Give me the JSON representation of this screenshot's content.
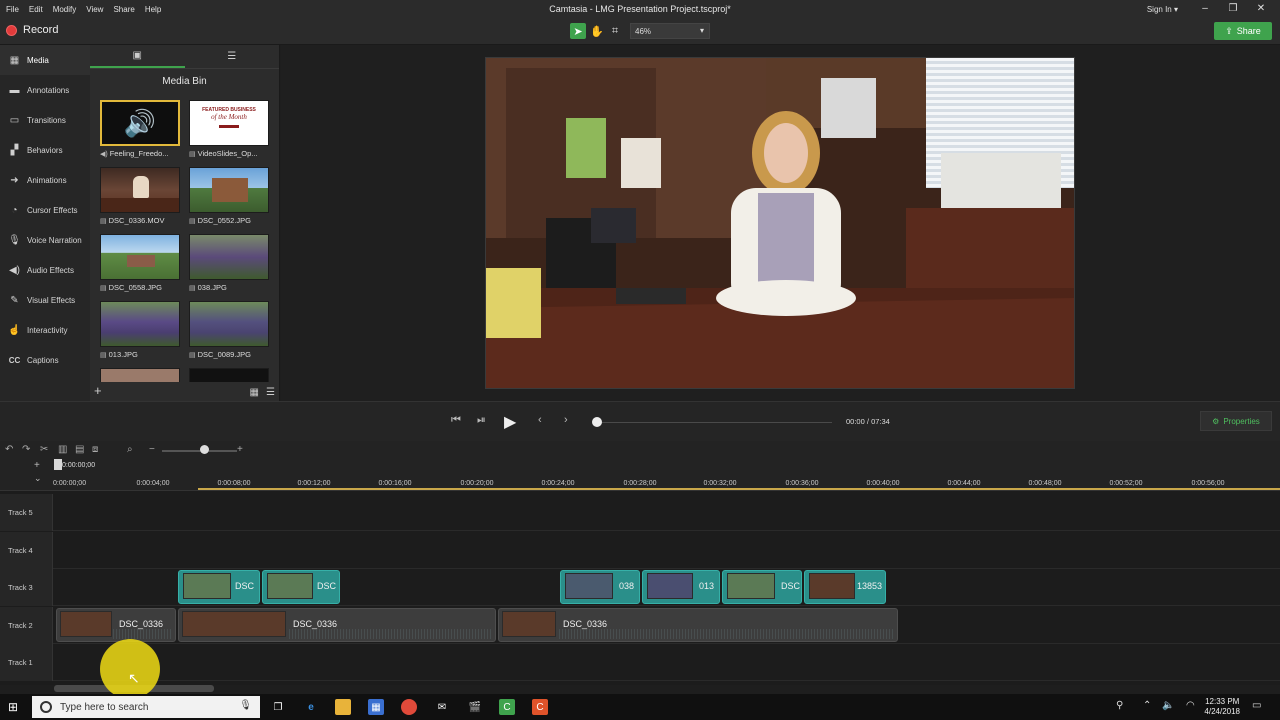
{
  "menu": {
    "items": [
      "File",
      "Edit",
      "Modify",
      "View",
      "Share",
      "Help"
    ],
    "title": "Camtasia - LMG Presentation Project.tscproj*",
    "signin": "Sign In"
  },
  "toolbar": {
    "record_label": "Record",
    "zoom_value": "46%",
    "share_label": "Share"
  },
  "sidebar": {
    "items": [
      {
        "label": "Media",
        "icon": "media-icon"
      },
      {
        "label": "Annotations",
        "icon": "annotations-icon"
      },
      {
        "label": "Transitions",
        "icon": "transitions-icon"
      },
      {
        "label": "Behaviors",
        "icon": "behaviors-icon"
      },
      {
        "label": "Animations",
        "icon": "animations-icon"
      },
      {
        "label": "Cursor Effects",
        "icon": "cursor-effects-icon"
      },
      {
        "label": "Voice Narration",
        "icon": "microphone-icon"
      },
      {
        "label": "Audio Effects",
        "icon": "audio-effects-icon"
      },
      {
        "label": "Visual Effects",
        "icon": "visual-effects-icon"
      },
      {
        "label": "Interactivity",
        "icon": "interactivity-icon"
      },
      {
        "label": "Captions",
        "icon": "captions-icon"
      }
    ]
  },
  "media_bin": {
    "title": "Media Bin",
    "items": [
      {
        "label": "Feeling_Freedo...",
        "type": "audio"
      },
      {
        "label": "VideoSlides_Op...",
        "type": "image"
      },
      {
        "label": "DSC_0336.MOV",
        "type": "video"
      },
      {
        "label": "DSC_0552.JPG",
        "type": "image"
      },
      {
        "label": "DSC_0558.JPG",
        "type": "image"
      },
      {
        "label": "038.JPG",
        "type": "image"
      },
      {
        "label": "013.JPG",
        "type": "image"
      },
      {
        "label": "DSC_0089.JPG",
        "type": "image"
      }
    ],
    "featured_thumb": {
      "line1": "FEATURED BUSINESS",
      "line2": "of the Month"
    }
  },
  "playback": {
    "current_time": "00:00",
    "separator": "/",
    "total_time": "07:34",
    "properties_label": "Properties"
  },
  "timeline": {
    "playhead_time": "0:00:00;00",
    "ruler_start": "0:00:00;00",
    "ruler_labels": [
      "0:00:04;00",
      "0:00:08;00",
      "0:00:12;00",
      "0:00:16;00",
      "0:00:20;00",
      "0:00:24;00",
      "0:00:28;00",
      "0:00:32;00",
      "0:00:36;00",
      "0:00:40;00",
      "0:00:44;00",
      "0:00:48;00",
      "0:00:52;00",
      "0:00:56;00"
    ],
    "tracks": [
      "Track 5",
      "Track 4",
      "Track 3",
      "Track 2",
      "Track 1"
    ],
    "track3_clips": [
      "DSC",
      "DSC",
      "038",
      "013",
      "DSC",
      "13853"
    ],
    "track2_clips": [
      "DSC_0336",
      "DSC_0336",
      "DSC_0336"
    ]
  },
  "taskbar": {
    "search_placeholder": "Type here to search",
    "time": "12:33 PM",
    "date": "4/24/2018"
  },
  "colors": {
    "accent": "#3fa34d",
    "record": "#e23b3b",
    "clip_teal": "#2a8f8a"
  }
}
